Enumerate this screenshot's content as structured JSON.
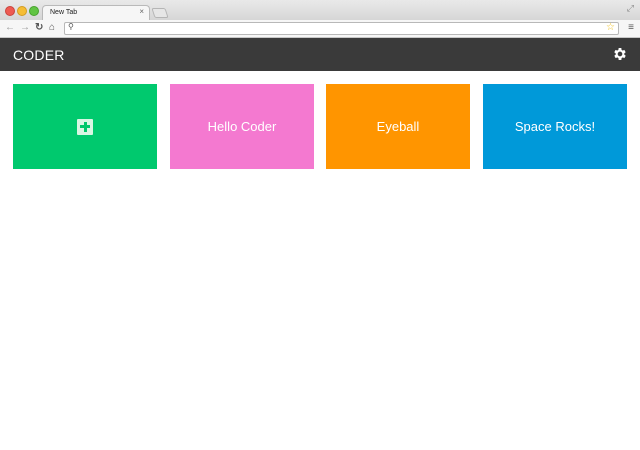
{
  "browser": {
    "tab_title": "New Tab",
    "tab_close": "×",
    "address_value": "",
    "address_placeholder": ""
  },
  "app": {
    "title": "CODER"
  },
  "tiles": [
    {
      "label": "",
      "icon": "add-icon",
      "color": "#00c96e"
    },
    {
      "label": "Hello Coder",
      "color": "#f479d0"
    },
    {
      "label": "Eyeball",
      "color": "#ff9500"
    },
    {
      "label": "Space Rocks!",
      "color": "#0099d9"
    }
  ],
  "colors": {
    "header_bg": "#3a3a3a",
    "page_bg": "#ffffff"
  }
}
